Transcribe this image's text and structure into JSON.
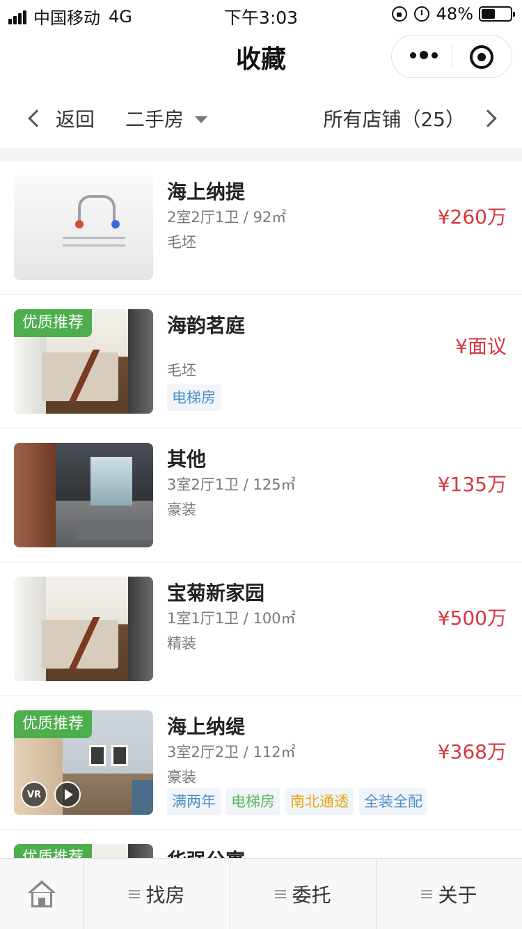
{
  "status_bar": {
    "carrier": "中国移动",
    "network": "4G",
    "time": "下午3:03",
    "battery": "48%",
    "battery_level": 0.48
  },
  "nav": {
    "title": "收藏"
  },
  "filter": {
    "back_label": "返回",
    "type_label": "二手房",
    "shop_label": "所有店铺（25）"
  },
  "listings": [
    {
      "title": "海上纳提",
      "layout": "2室2厅1卫 / 92㎡",
      "decoration": "毛坯",
      "price": "¥260万",
      "badge": "",
      "tags": []
    },
    {
      "title": "海韵茗庭",
      "layout": "",
      "decoration": "毛坯",
      "price": "¥面议",
      "badge": "优质推荐",
      "tags": [
        {
          "label": "电梯房",
          "color": "#4a90c8"
        }
      ]
    },
    {
      "title": "其他",
      "layout": "3室2厅1卫 / 125㎡",
      "decoration": "豪装",
      "price": "¥135万",
      "badge": "",
      "tags": []
    },
    {
      "title": "宝菊新家园",
      "layout": "1室1厅1卫 / 100㎡",
      "decoration": "精装",
      "price": "¥500万",
      "badge": "",
      "tags": []
    },
    {
      "title": "海上纳缇",
      "layout": "3室2厅2卫 / 112㎡",
      "decoration": "豪装",
      "price": "¥368万",
      "badge": "优质推荐",
      "media": {
        "vr_label": "VR"
      },
      "tags": [
        {
          "label": "满两年",
          "color": "#4a90c8"
        },
        {
          "label": "电梯房",
          "color": "#5cb85c"
        },
        {
          "label": "南北通透",
          "color": "#e6a817"
        },
        {
          "label": "全装全配",
          "color": "#4a90c8"
        }
      ]
    },
    {
      "title": "华强公寓",
      "badge": "优质推荐"
    }
  ],
  "tabbar": {
    "items": [
      {
        "label": "找房"
      },
      {
        "label": "委托"
      },
      {
        "label": "关于"
      }
    ]
  },
  "colors": {
    "price": "#d9363e",
    "badge": "#4cae4c",
    "accent_text": "#333333"
  }
}
